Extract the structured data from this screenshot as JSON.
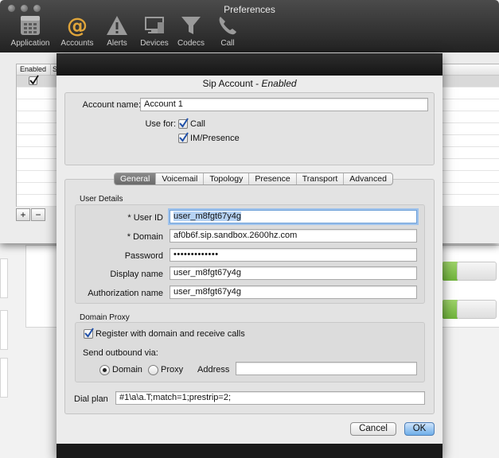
{
  "preferences": {
    "title": "Preferences",
    "toolbar": [
      {
        "label": "Application",
        "icon": "application-icon"
      },
      {
        "label": "Accounts",
        "icon": "at-sign-icon"
      },
      {
        "label": "Alerts",
        "icon": "alert-triangle-icon"
      },
      {
        "label": "Devices",
        "icon": "devices-icon"
      },
      {
        "label": "Codecs",
        "icon": "funnel-icon"
      },
      {
        "label": "Call",
        "icon": "phone-icon"
      }
    ],
    "table": {
      "columns": [
        "Enabled",
        "S"
      ]
    },
    "add_label": "+",
    "remove_label": "−"
  },
  "sheet": {
    "title": "Sip Account - ",
    "title_status": "Enabled",
    "account_name_label": "Account name:",
    "account_name_value": "Account 1",
    "use_for_label": "Use for:",
    "use_for_call": "Call",
    "use_for_im": "IM/Presence",
    "tabs": [
      "General",
      "Voicemail",
      "Topology",
      "Presence",
      "Transport",
      "Advanced"
    ],
    "active_tab": "General",
    "user_details": {
      "section_label": "User Details",
      "user_id_label": "* User ID",
      "user_id_value": "user_m8fgt67y4g",
      "domain_label": "* Domain",
      "domain_value": "af0b6f.sip.sandbox.2600hz.com",
      "password_label": "Password",
      "password_value": "•••••••••••••",
      "display_name_label": "Display name",
      "display_name_value": "user_m8fgt67y4g",
      "auth_name_label": "Authorization name",
      "auth_name_value": "user_m8fgt67y4g"
    },
    "domain_proxy": {
      "section_label": "Domain Proxy",
      "register_label": "Register with domain and receive calls",
      "send_outbound_label": "Send outbound via:",
      "option_domain": "Domain",
      "option_proxy": "Proxy",
      "address_label": "Address",
      "address_value": ""
    },
    "dial_plan_label": "Dial plan",
    "dial_plan_value": "#1\\a\\a.T;match=1;prestrip=2;",
    "cancel_label": "Cancel",
    "ok_label": "OK"
  },
  "colors": {
    "accent_blue": "#6eaee9",
    "accounts_icon": "#e0a53a",
    "toolbar_bg": "#2f2f2f"
  }
}
